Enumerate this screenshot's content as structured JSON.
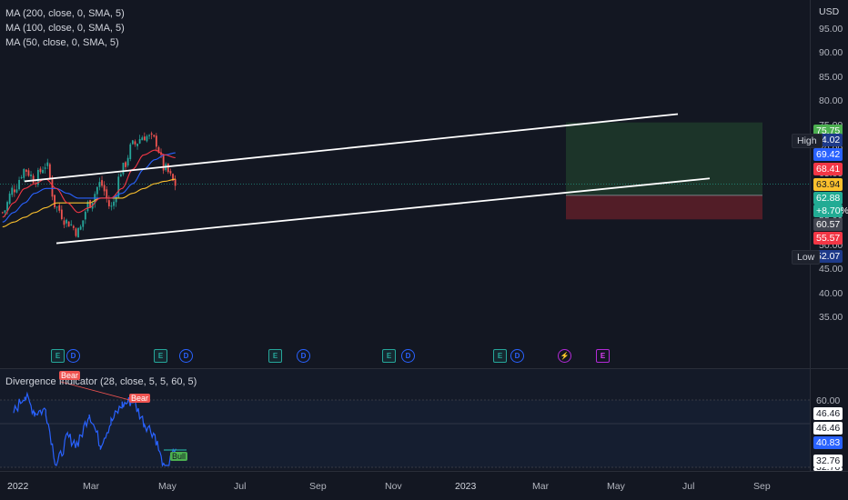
{
  "legend": {
    "ma200": "MA (200, close, 0, SMA, 5)",
    "ma100": "MA (100, close, 0, SMA, 5)",
    "ma50": "MA (50, close, 0, SMA, 5)",
    "indicator": "Divergence Indicator (28, close, 5, 5, 60, 5)"
  },
  "price_axis": {
    "currency": "USD",
    "ticks": [
      "95.00",
      "90.00",
      "85.00",
      "80.00",
      "75.00",
      "70.00",
      "65.00",
      "60.00",
      "55.00",
      "50.00",
      "45.00",
      "40.00",
      "35.00"
    ]
  },
  "price_labels": [
    {
      "id": "target",
      "text": "75.75",
      "color": "#4caf50"
    },
    {
      "id": "high",
      "text": "74.02",
      "color": "#1e3a8a",
      "tag": "High"
    },
    {
      "id": "ma100",
      "text": "69.42",
      "color": "#2962ff"
    },
    {
      "id": "ma50",
      "text": "68.41",
      "color": "#f23645"
    },
    {
      "id": "ma200",
      "text": "63.94",
      "color": "#fbc02d"
    },
    {
      "id": "last",
      "text": "62.88",
      "sub": "+8.70%",
      "color": "#22ab94"
    },
    {
      "id": "entry",
      "text": "60.57",
      "color": "#434651"
    },
    {
      "id": "stop",
      "text": "55.57",
      "color": "#f23645"
    },
    {
      "id": "low",
      "text": "52.07",
      "color": "#1e3a8a",
      "tag": "Low"
    }
  ],
  "osc_axis": {
    "labels": [
      {
        "text": "60.00",
        "style": "plain"
      },
      {
        "text": "46.46",
        "style": "white"
      },
      {
        "text": "46.46",
        "style": "white"
      },
      {
        "text": "40.83",
        "style": "blue"
      },
      {
        "text": "32.76",
        "style": "white"
      },
      {
        "text": "32.76",
        "style": "white"
      }
    ]
  },
  "time_axis": [
    "2022",
    "Mar",
    "May",
    "Jul",
    "Sep",
    "Nov",
    "2023",
    "Mar",
    "May",
    "Jul",
    "Sep"
  ],
  "events": [
    {
      "text": "E",
      "kind": "earnings"
    },
    {
      "text": "D",
      "kind": "dividend"
    },
    {
      "text": "E",
      "kind": "earnings"
    },
    {
      "text": "D",
      "kind": "dividend"
    },
    {
      "text": "E",
      "kind": "earnings"
    },
    {
      "text": "D",
      "kind": "dividend"
    },
    {
      "text": "E",
      "kind": "earnings"
    },
    {
      "text": "D",
      "kind": "dividend"
    },
    {
      "text": "E",
      "kind": "earnings"
    },
    {
      "text": "D",
      "kind": "dividend"
    },
    {
      "text": "⚡",
      "kind": "split"
    },
    {
      "text": "E",
      "kind": "future-earnings"
    }
  ],
  "signals": [
    {
      "text": "Bear",
      "type": "bear"
    },
    {
      "text": "Bear",
      "type": "bear"
    },
    {
      "text": "Bull",
      "type": "bull"
    }
  ],
  "colors": {
    "bg": "#131722",
    "up": "#26a69a",
    "down": "#ef5350",
    "ma200": "#fbc02d",
    "ma100": "#2962ff",
    "ma50": "#f23645",
    "channel": "#ffffff",
    "oscillator": "#2962ff"
  },
  "chart_data": {
    "type": "candlestick",
    "ohlc_note": "approximate weekly-like closes read from chart",
    "x": [
      "2021-12-01",
      "2022-01-01",
      "2022-02-01",
      "2022-03-01",
      "2022-04-01",
      "2022-05-01",
      "2022-06-01",
      "2022-07-01",
      "2022-08-01",
      "2022-09-01",
      "2022-10-01",
      "2022-11-01",
      "2022-12-01",
      "2023-01-01",
      "2023-02-01",
      "2023-03-01",
      "2023-03-31"
    ],
    "close": [
      57,
      62,
      66,
      64,
      67,
      58,
      55,
      53,
      59,
      63,
      58,
      66,
      71,
      73,
      72,
      66,
      62.88
    ],
    "ma50": [
      56,
      59,
      62,
      63,
      64,
      62,
      59,
      57,
      58,
      60,
      60,
      62,
      66,
      69,
      70,
      69,
      68.41
    ],
    "ma100": [
      55,
      57,
      59,
      61,
      62,
      62,
      61,
      60,
      60,
      60,
      60,
      61,
      63,
      66,
      68,
      69,
      69.42
    ],
    "ma200": [
      54,
      55,
      56,
      57,
      58,
      59,
      59,
      59,
      59,
      60,
      60,
      60,
      61,
      62,
      63,
      63.5,
      63.94
    ],
    "oscillator": [
      {
        "x": "2022-01",
        "y": 55
      },
      {
        "x": "2022-02",
        "y": 62
      },
      {
        "x": "2022-03",
        "y": 55
      },
      {
        "x": "2022-04",
        "y": 56
      },
      {
        "x": "2022-05",
        "y": 33
      },
      {
        "x": "2022-06",
        "y": 45
      },
      {
        "x": "2022-07",
        "y": 42
      },
      {
        "x": "2022-08",
        "y": 55
      },
      {
        "x": "2022-09",
        "y": 42
      },
      {
        "x": "2022-10",
        "y": 51
      },
      {
        "x": "2022-11",
        "y": 58
      },
      {
        "x": "2022-12",
        "y": 60
      },
      {
        "x": "2023-01",
        "y": 51
      },
      {
        "x": "2023-02",
        "y": 46
      },
      {
        "x": "2023-03",
        "y": 30
      },
      {
        "x": "2023-04",
        "y": 40.83
      }
    ],
    "position": {
      "target": 75.75,
      "entry": 60.57,
      "stop": 55.57
    },
    "high": 74.02,
    "low": 52.07,
    "y_range": [
      31,
      99
    ]
  }
}
